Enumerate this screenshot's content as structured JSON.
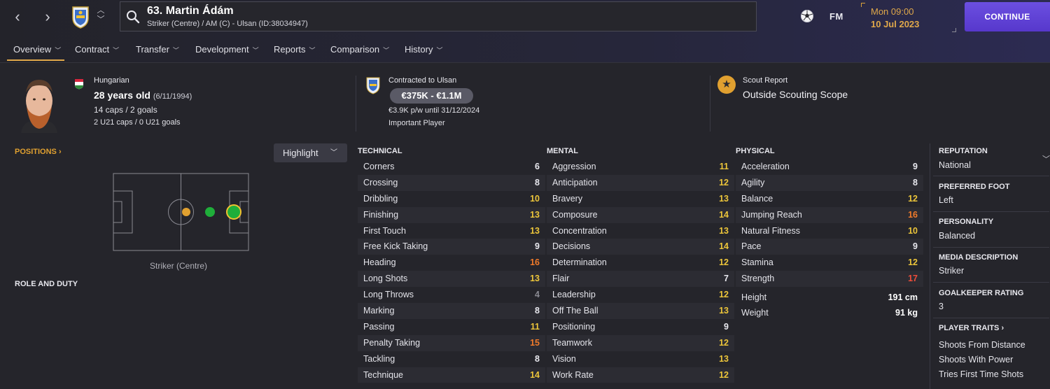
{
  "header": {
    "back_icon": "chevron-left-icon",
    "forward_icon": "chevron-right-icon",
    "player_title": "63. Martin Ádám",
    "player_subtitle": "Striker (Centre) / AM (C) - Ulsan (ID:38034947)",
    "fm_label": "FM",
    "date_day": "Mon 09:00",
    "date_date": "10 Jul 2023",
    "continue_label": "CONTINUE",
    "accent_color": "#e0a84a",
    "continue_color": "#6b4fe0"
  },
  "tabs": [
    {
      "label": "Overview"
    },
    {
      "label": "Contract"
    },
    {
      "label": "Transfer"
    },
    {
      "label": "Development"
    },
    {
      "label": "Reports"
    },
    {
      "label": "Comparison"
    },
    {
      "label": "History"
    }
  ],
  "bio": {
    "nationality": "Hungarian",
    "age": "28 years old",
    "dob": "(6/11/1994)",
    "caps": "14 caps / 2 goals",
    "u21": "2 U21 caps / 0 U21 goals"
  },
  "contract": {
    "club": "Contracted to Ulsan",
    "value": "€375K - €1.1M",
    "wage": "€3.9K p/w until 31/12/2024",
    "status": "Important Player"
  },
  "scout": {
    "title": "Scout Report",
    "value": "Outside Scouting Scope"
  },
  "positions": {
    "label": "POSITIONS ›",
    "highlight_label": "Highlight",
    "pitch_caption": "Striker (Centre)",
    "role_label": "ROLE AND DUTY"
  },
  "technical": {
    "heading": "TECHNICAL",
    "rows": [
      {
        "name": "Corners",
        "value": "6",
        "tone": "white"
      },
      {
        "name": "Crossing",
        "value": "8",
        "tone": "white"
      },
      {
        "name": "Dribbling",
        "value": "10",
        "tone": "yellow"
      },
      {
        "name": "Finishing",
        "value": "13",
        "tone": "yellow"
      },
      {
        "name": "First Touch",
        "value": "13",
        "tone": "yellow"
      },
      {
        "name": "Free Kick Taking",
        "value": "9",
        "tone": "white"
      },
      {
        "name": "Heading",
        "value": "16",
        "tone": "orange"
      },
      {
        "name": "Long Shots",
        "value": "13",
        "tone": "yellow"
      },
      {
        "name": "Long Throws",
        "value": "4",
        "tone": "grey"
      },
      {
        "name": "Marking",
        "value": "8",
        "tone": "white"
      },
      {
        "name": "Passing",
        "value": "11",
        "tone": "yellow"
      },
      {
        "name": "Penalty Taking",
        "value": "15",
        "tone": "orange"
      },
      {
        "name": "Tackling",
        "value": "8",
        "tone": "white"
      },
      {
        "name": "Technique",
        "value": "14",
        "tone": "yellow"
      }
    ]
  },
  "mental": {
    "heading": "MENTAL",
    "rows": [
      {
        "name": "Aggression",
        "value": "11",
        "tone": "yellow"
      },
      {
        "name": "Anticipation",
        "value": "12",
        "tone": "yellow"
      },
      {
        "name": "Bravery",
        "value": "13",
        "tone": "yellow"
      },
      {
        "name": "Composure",
        "value": "14",
        "tone": "yellow"
      },
      {
        "name": "Concentration",
        "value": "13",
        "tone": "yellow"
      },
      {
        "name": "Decisions",
        "value": "14",
        "tone": "yellow"
      },
      {
        "name": "Determination",
        "value": "12",
        "tone": "yellow"
      },
      {
        "name": "Flair",
        "value": "7",
        "tone": "white"
      },
      {
        "name": "Leadership",
        "value": "12",
        "tone": "yellow"
      },
      {
        "name": "Off The Ball",
        "value": "13",
        "tone": "yellow"
      },
      {
        "name": "Positioning",
        "value": "9",
        "tone": "white"
      },
      {
        "name": "Teamwork",
        "value": "12",
        "tone": "yellow"
      },
      {
        "name": "Vision",
        "value": "13",
        "tone": "yellow"
      },
      {
        "name": "Work Rate",
        "value": "12",
        "tone": "yellow"
      }
    ]
  },
  "physical": {
    "heading": "PHYSICAL",
    "rows": [
      {
        "name": "Acceleration",
        "value": "9",
        "tone": "white"
      },
      {
        "name": "Agility",
        "value": "8",
        "tone": "white"
      },
      {
        "name": "Balance",
        "value": "12",
        "tone": "yellow"
      },
      {
        "name": "Jumping Reach",
        "value": "16",
        "tone": "orange"
      },
      {
        "name": "Natural Fitness",
        "value": "10",
        "tone": "yellow"
      },
      {
        "name": "Pace",
        "value": "9",
        "tone": "white"
      },
      {
        "name": "Stamina",
        "value": "12",
        "tone": "yellow"
      },
      {
        "name": "Strength",
        "value": "17",
        "tone": "red"
      }
    ],
    "height_label": "Height",
    "height_value": "191 cm",
    "weight_label": "Weight",
    "weight_value": "91 kg"
  },
  "profile": {
    "reputation_label": "REPUTATION",
    "reputation_value": "National",
    "foot_label": "PREFERRED FOOT",
    "foot_value": "Left",
    "personality_label": "PERSONALITY",
    "personality_value": "Balanced",
    "media_label": "MEDIA DESCRIPTION",
    "media_value": "Striker",
    "gk_label": "GOALKEEPER RATING",
    "gk_value": "3",
    "traits_label": "PLAYER TRAITS ›",
    "traits": [
      "Shoots From Distance",
      "Shoots With Power",
      "Tries First Time Shots"
    ]
  }
}
